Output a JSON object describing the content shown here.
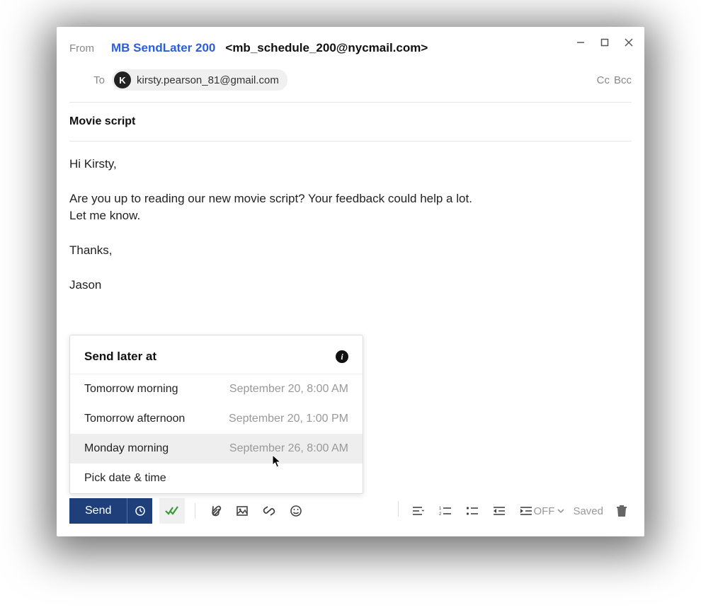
{
  "from": {
    "label": "From",
    "name": "MB SendLater 200",
    "email": "<mb_schedule_200@nycmail.com>"
  },
  "to": {
    "label": "To",
    "recipient_initial": "K",
    "recipient_email": "kirsty.pearson_81@gmail.com",
    "cc": "Cc",
    "bcc": "Bcc"
  },
  "subject": "Movie script",
  "body": {
    "greeting": "Hi Kirsty,",
    "line1": "Are you up to reading our new movie script? Your feedback could help a lot.",
    "line2": "Let me know.",
    "thanks": "Thanks,",
    "signature": "Jason"
  },
  "popup": {
    "title": "Send later at",
    "options": [
      {
        "label": "Tomorrow morning",
        "date": "September 20, 8:00 AM"
      },
      {
        "label": "Tomorrow afternoon",
        "date": "September 20, 1:00 PM"
      },
      {
        "label": "Monday morning",
        "date": "September 26, 8:00 AM"
      },
      {
        "label": "Pick date & time",
        "date": ""
      }
    ]
  },
  "toolbar": {
    "send": "Send",
    "off": "OFF",
    "saved": "Saved"
  }
}
